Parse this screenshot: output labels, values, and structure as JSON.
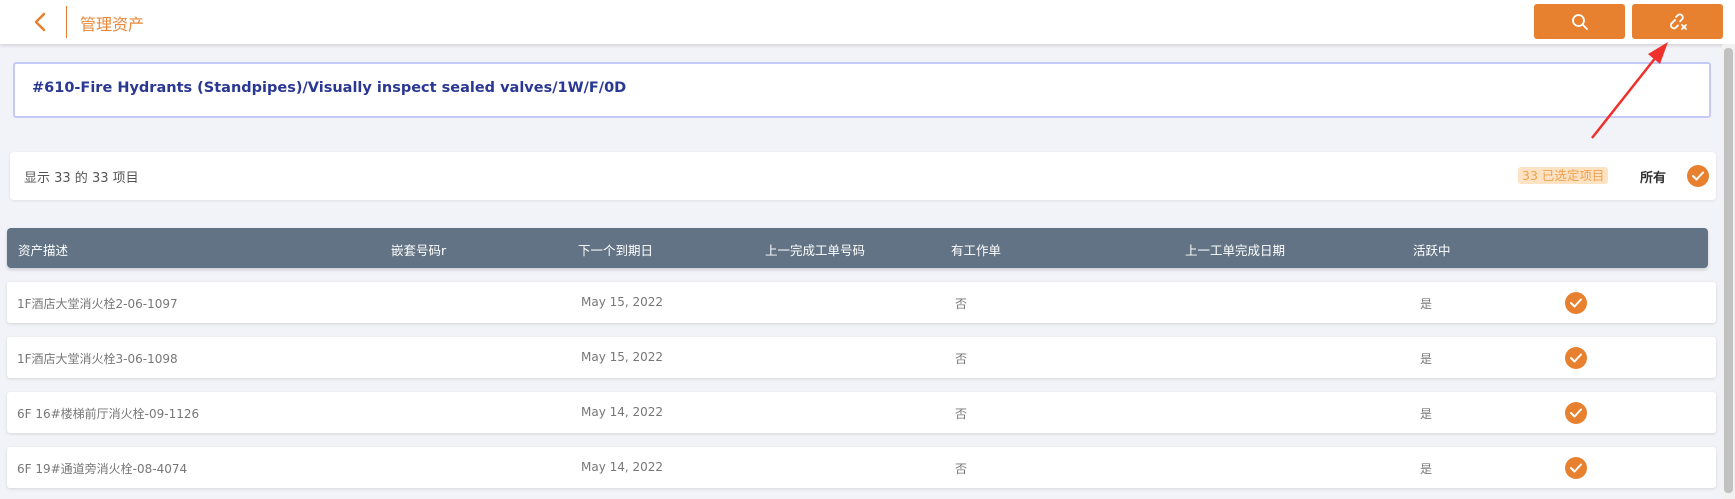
{
  "header": {
    "title": "管理资产",
    "back_icon": "chevron-left-icon",
    "search_icon": "search-icon",
    "unlink_icon": "unlink-icon",
    "accent_color": "#e8812f"
  },
  "work_order": {
    "title": "#610-Fire Hydrants (Standpipes)/Visually inspect sealed valves/1W/F/0D"
  },
  "summary": {
    "count_text": "显示 33 的 33 项目",
    "selected_badge": "33 已选定项目",
    "all_label": "所有"
  },
  "table": {
    "columns": [
      "资产描述",
      "嵌套号码r",
      "下一个到期日",
      "上一完成工单号码",
      "有工作单",
      "上一工单完成日期",
      "活跃中"
    ],
    "rows": [
      {
        "description": "1F酒店大堂消火栓2-06-1097",
        "nested": "",
        "next_due": "May 15, 2022",
        "last_wo": "",
        "has_wo": "否",
        "last_completed": "",
        "active": "是",
        "selected": true
      },
      {
        "description": "1F酒店大堂消火栓3-06-1098",
        "nested": "",
        "next_due": "May 15, 2022",
        "last_wo": "",
        "has_wo": "否",
        "last_completed": "",
        "active": "是",
        "selected": true
      },
      {
        "description": "6F 16#楼梯前厅消火栓-09-1126",
        "nested": "",
        "next_due": "May 14, 2022",
        "last_wo": "",
        "has_wo": "否",
        "last_completed": "",
        "active": "是",
        "selected": true
      },
      {
        "description": "6F 19#通道旁消火栓-08-4074",
        "nested": "",
        "next_due": "May 14, 2022",
        "last_wo": "",
        "has_wo": "否",
        "last_completed": "",
        "active": "是",
        "selected": true
      }
    ]
  }
}
